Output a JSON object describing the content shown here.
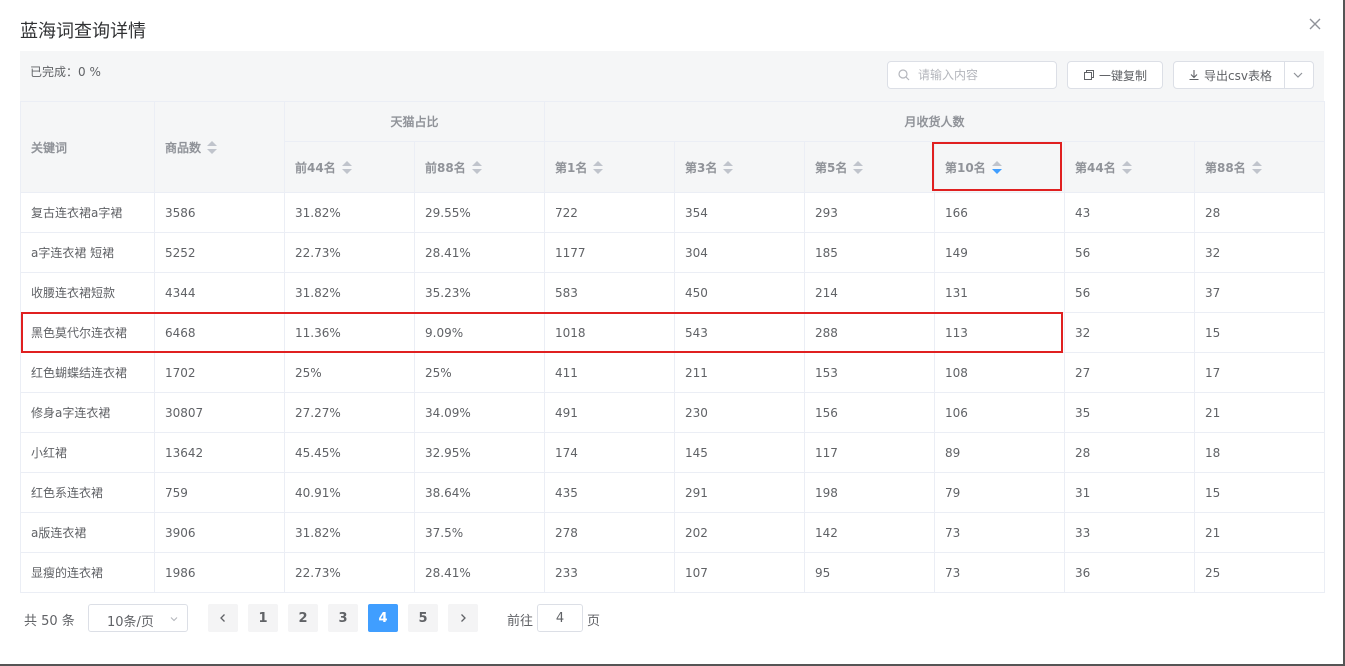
{
  "dialog": {
    "title": "蓝海词查询详情",
    "progress_text": "已完成：0 %"
  },
  "toolbar": {
    "search_placeholder": "请输入内容",
    "copy_label": "一键复制",
    "export_label": "导出csv表格"
  },
  "table": {
    "col_keyword": "关键词",
    "col_goods": "商品数",
    "group_tmall": "天猫占比",
    "group_buyers": "月收货人数",
    "sub_headers": [
      "前44名",
      "前88名",
      "第1名",
      "第3名",
      "第5名",
      "第10名",
      "第44名",
      "第88名"
    ],
    "rows": [
      [
        "复古连衣裙a字裙",
        "3586",
        "31.82%",
        "29.55%",
        "722",
        "354",
        "293",
        "166",
        "43",
        "28"
      ],
      [
        "a字连衣裙 短裙",
        "5252",
        "22.73%",
        "28.41%",
        "1177",
        "304",
        "185",
        "149",
        "56",
        "32"
      ],
      [
        "收腰连衣裙短款",
        "4344",
        "31.82%",
        "35.23%",
        "583",
        "450",
        "214",
        "131",
        "56",
        "37"
      ],
      [
        "黑色莫代尔连衣裙",
        "6468",
        "11.36%",
        "9.09%",
        "1018",
        "543",
        "288",
        "113",
        "32",
        "15"
      ],
      [
        "红色蝴蝶结连衣裙",
        "1702",
        "25%",
        "25%",
        "411",
        "211",
        "153",
        "108",
        "27",
        "17"
      ],
      [
        "修身a字连衣裙",
        "30807",
        "27.27%",
        "34.09%",
        "491",
        "230",
        "156",
        "106",
        "35",
        "21"
      ],
      [
        "小红裙",
        "13642",
        "45.45%",
        "32.95%",
        "174",
        "145",
        "117",
        "89",
        "28",
        "18"
      ],
      [
        "红色系连衣裙",
        "759",
        "40.91%",
        "38.64%",
        "435",
        "291",
        "198",
        "79",
        "31",
        "15"
      ],
      [
        "a版连衣裙",
        "3906",
        "31.82%",
        "37.5%",
        "278",
        "202",
        "142",
        "73",
        "33",
        "21"
      ],
      [
        "显瘦的连衣裙",
        "1986",
        "22.73%",
        "28.41%",
        "233",
        "107",
        "95",
        "73",
        "36",
        "25"
      ]
    ],
    "sorted_column": "第10名",
    "sort_direction": "descending",
    "highlighted_row": "黑色莫代尔连衣裙"
  },
  "pagination": {
    "total_text": "共 50 条",
    "page_size": "10条/页",
    "pages": [
      "1",
      "2",
      "3",
      "4",
      "5"
    ],
    "current_page": "4",
    "goto_prefix": "前往",
    "goto_value": "4",
    "goto_suffix": "页"
  },
  "colors": {
    "accent": "#409eff",
    "highlight_border": "#e02020",
    "header_bg": "#f5f6f7"
  },
  "icons": {
    "close": "close-icon",
    "search": "search-icon",
    "copy": "copy-icon",
    "export": "download-icon",
    "dropdown": "chevron-down-icon",
    "prev": "chevron-left-icon",
    "next": "chevron-right-icon"
  }
}
